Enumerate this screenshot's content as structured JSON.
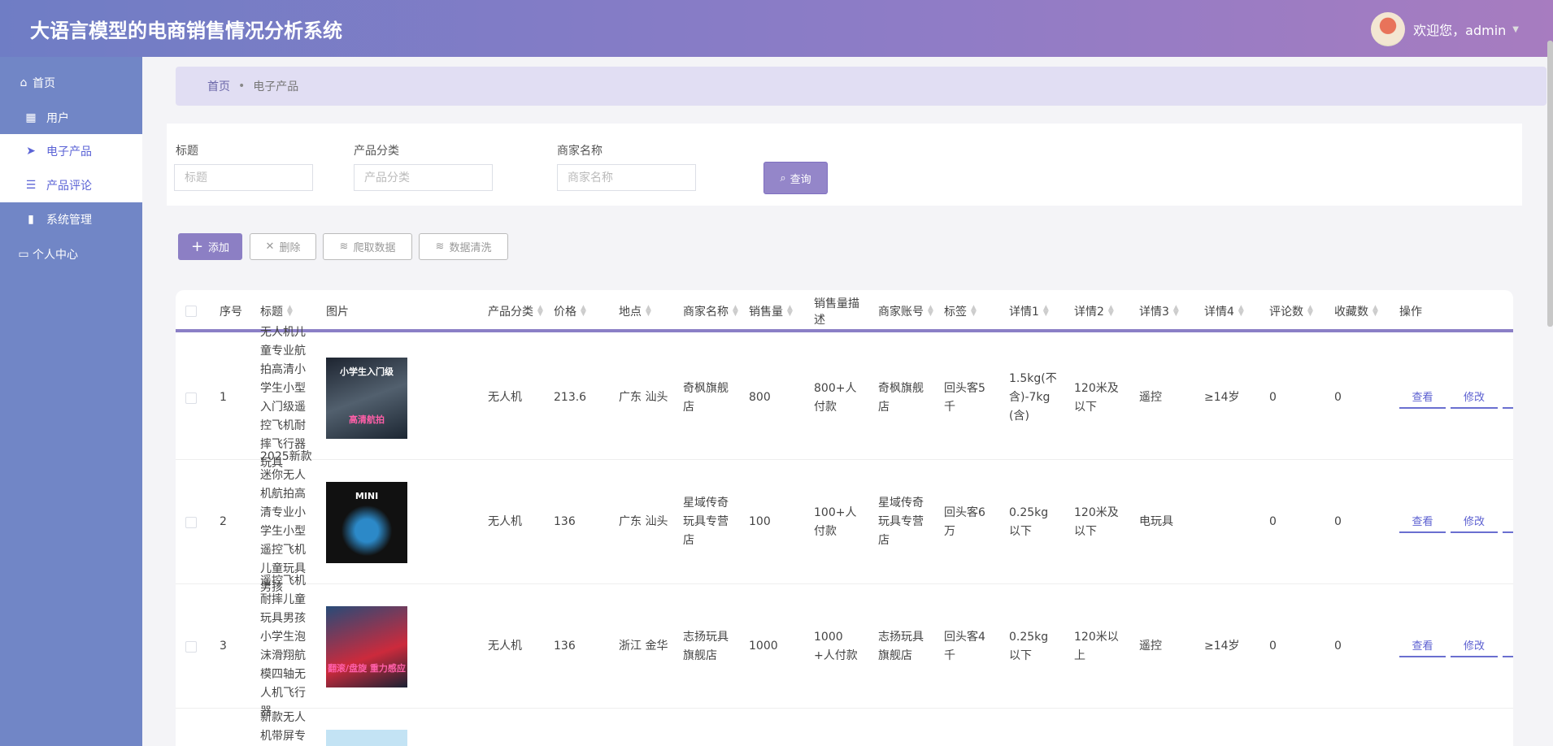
{
  "header": {
    "title": "大语言模型的电商销售情况分析系统",
    "welcome": "欢迎您，admin"
  },
  "sidebar": {
    "items": [
      {
        "label": "首页",
        "icon": "home-icon"
      },
      {
        "label": "用户",
        "icon": "grid-icon"
      },
      {
        "label": "电子产品",
        "icon": "paper-plane-icon"
      },
      {
        "label": "产品评论",
        "icon": "list-icon"
      },
      {
        "label": "系统管理",
        "icon": "book-icon"
      },
      {
        "label": "个人中心",
        "icon": "wallet-icon"
      }
    ]
  },
  "breadcrumb": {
    "home": "首页",
    "current": "电子产品"
  },
  "search": {
    "title_label": "标题",
    "title_placeholder": "标题",
    "category_label": "产品分类",
    "category_placeholder": "产品分类",
    "merchant_label": "商家名称",
    "merchant_placeholder": "商家名称",
    "query_button": "查询"
  },
  "toolbar": {
    "add": "添加",
    "delete": "删除",
    "crawl": "爬取数据",
    "clean": "数据清洗"
  },
  "table": {
    "columns": [
      "序号",
      "标题",
      "图片",
      "产品分类",
      "价格",
      "地点",
      "商家名称",
      "销售量",
      "销售量描述",
      "商家账号",
      "标签",
      "详情1",
      "详情2",
      "详情3",
      "详情4",
      "评论数",
      "收藏数",
      "操作"
    ],
    "rows": [
      {
        "index": "1",
        "title": "无人机儿童专业航拍高清小学生小型入门级遥控飞机耐摔飞行器玩具",
        "image_text": "小学生入门级",
        "image_text2": "高清航拍",
        "category": "无人机",
        "price": "213.6",
        "location": "广东 汕头",
        "merchant": "奇枫旗舰店",
        "sales": "800",
        "sales_desc": "800+人付款",
        "account": "奇枫旗舰店",
        "tag": "回头客5千",
        "d1": "1.5kg(不含)-7kg(含)",
        "d2": "120米及以下",
        "d3": "遥控",
        "d4": "≥14岁",
        "comments": "0",
        "favorites": "0"
      },
      {
        "index": "2",
        "title": "2025新款迷你无人机航拍高清专业小学生小型遥控飞机儿童玩具男孩",
        "image_text": "MINI",
        "image_text2": "",
        "category": "无人机",
        "price": "136",
        "location": "广东 汕头",
        "merchant": "星域传奇玩具专营店",
        "sales": "100",
        "sales_desc": "100+人付款",
        "account": "星域传奇玩具专营店",
        "tag": "回头客6万",
        "d1": "0.25kg以下",
        "d2": "120米及以下",
        "d3": "电玩具",
        "d4": "",
        "comments": "0",
        "favorites": "0"
      },
      {
        "index": "3",
        "title": "遥控飞机耐摔儿童玩具男孩小学生泡沫滑翔航模四轴无人机飞行器",
        "image_text": "",
        "image_text2": "翻滚/盘旋 重力感应",
        "category": "无人机",
        "price": "136",
        "location": "浙江 金华",
        "merchant": "志扬玩具旗舰店",
        "sales": "1000",
        "sales_desc": "1000+人付款",
        "account": "志扬玩具旗舰店",
        "tag": "回头客4千",
        "d1": "0.25kg以下",
        "d2": "120米以上",
        "d3": "遥控",
        "d4": "≥14岁",
        "comments": "0",
        "favorites": "0"
      },
      {
        "index": "",
        "title": "新款无人机带屏专业高",
        "image_text": "",
        "image_text2": "",
        "category": "",
        "price": "",
        "location": "",
        "merchant": "",
        "sales": "",
        "sales_desc": "",
        "account": "",
        "tag": "",
        "d1": "",
        "d2": "",
        "d3": "",
        "d4": "",
        "comments": "",
        "favorites": ""
      }
    ],
    "actions": {
      "view": "查看",
      "edit": "修改"
    }
  }
}
